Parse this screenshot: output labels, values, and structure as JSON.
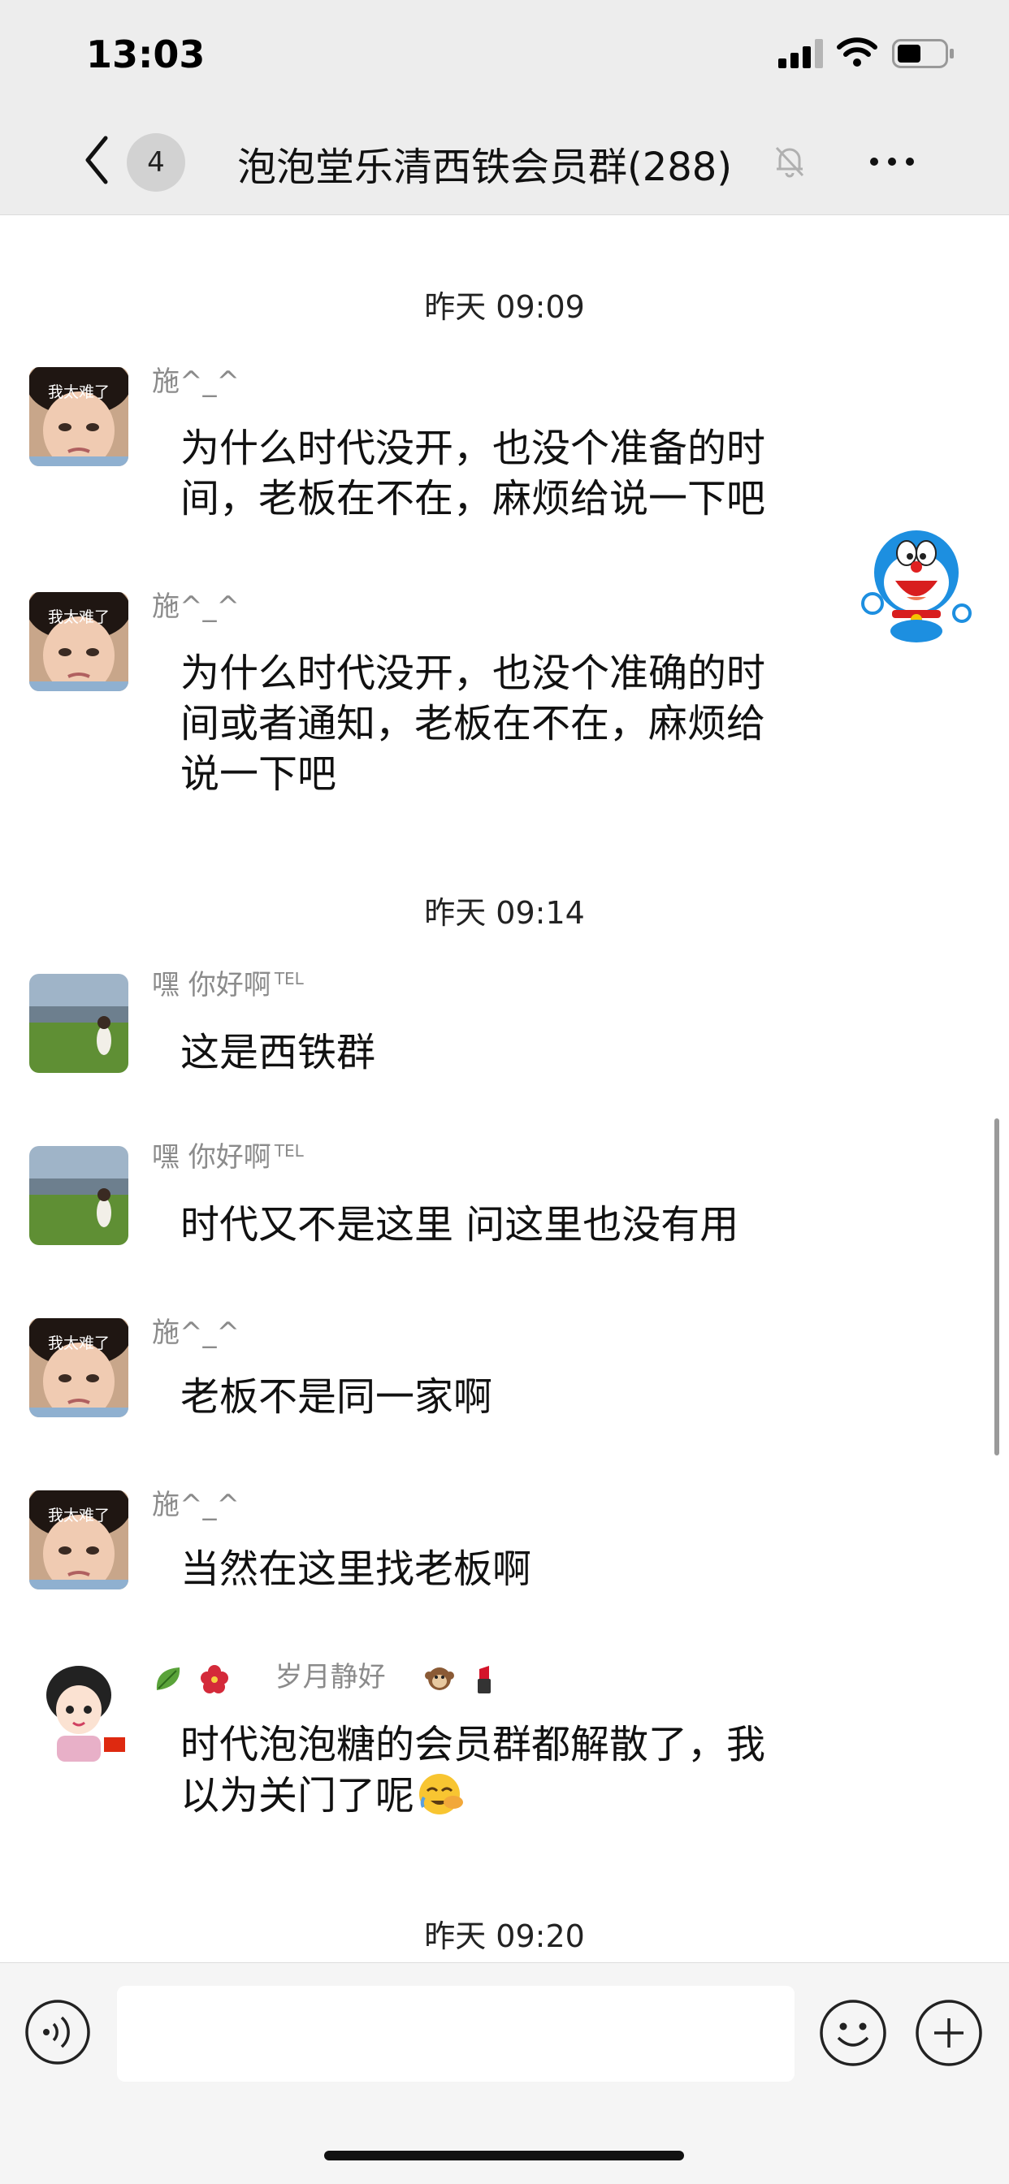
{
  "status_bar": {
    "time": "13:03"
  },
  "header": {
    "unread_count": "4",
    "title": "泡泡堂乐清西铁会员群(288)"
  },
  "messages": [
    {
      "timestamp": "昨天 09:09"
    },
    {
      "sender": "施^_^",
      "avatar_text": "我太难了",
      "text_lines": [
        "为什么时代没开，也没个准备的时",
        "间，老板在不在，麻烦给说一下吧"
      ]
    },
    {
      "sender": "施^_^",
      "avatar_text": "我太难了",
      "text_lines": [
        "为什么时代没开，也没个准确的时",
        "间或者通知，老板在不在，麻烦给",
        "说一下吧"
      ]
    },
    {
      "timestamp": "昨天 09:14"
    },
    {
      "sender": "嘿  你好啊",
      "sender_suffix": "TEL",
      "text": "这是西铁群"
    },
    {
      "sender": "嘿  你好啊",
      "sender_suffix": "TEL",
      "text": "时代又不是这里  问这里也没有用"
    },
    {
      "sender": "施^_^",
      "avatar_text": "我太难了",
      "text": "老板不是同一家啊"
    },
    {
      "sender": "施^_^",
      "avatar_text": "我太难了",
      "text": "当然在这里找老板啊"
    },
    {
      "sender": "岁月静好",
      "text_lines": [
        "时代泡泡糖的会员群都解散了，我",
        "以为关门了呢"
      ]
    },
    {
      "timestamp": "昨天 09:20"
    }
  ],
  "icons": {
    "back": "chevron-left-icon",
    "mute": "bell-off-icon",
    "more": "more-dots-icon",
    "voice": "voice-icon",
    "emoji": "emoji-icon",
    "plus": "plus-icon",
    "sticker": "doraemon-sticker"
  },
  "colors": {
    "header_bg": "#ededed",
    "chat_bg": "#ffffff",
    "nickname": "#8b8b8b"
  }
}
